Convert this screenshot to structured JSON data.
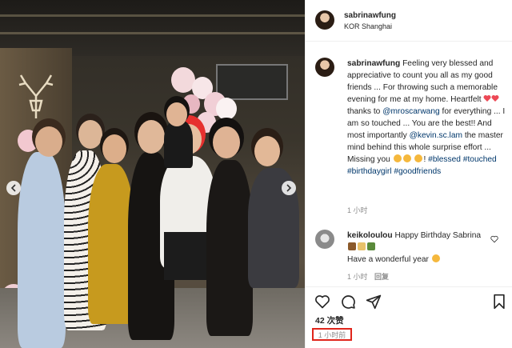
{
  "post": {
    "header": {
      "username": "sabrinawfung",
      "location": "KOR Shanghai"
    },
    "caption": {
      "username": "sabrinawfung",
      "text_1": "Feeling very blessed and appreciative to count you all as my good friends ... For throwing such a memorable evening for me at my home. Heartfelt",
      "text_2": "thanks to",
      "mention_1": "@mroscarwang",
      "text_3": "for everything ... I am so touched ... You are the best!! And most importantly",
      "mention_2": "@kevin.sc.lam",
      "text_4": "the master mind behind this whole surprise effort ... Missing you",
      "text_5": "!",
      "hashtags": [
        "#blessed",
        "#touched",
        "#birthdaygirl",
        "#goodfriends"
      ],
      "time": "1 小时"
    },
    "comment": {
      "username": "keikoloulou",
      "text_1": "Happy Birthday Sabrina",
      "text_2": "Have a wonderful year",
      "time": "1 小时",
      "reply_label": "回复"
    },
    "likes_text": "42 次赞",
    "timestamp": "1 小时前"
  },
  "icons": {
    "like": "heart-outline-icon",
    "comment": "comment-icon",
    "share": "paper-plane-icon",
    "save": "bookmark-icon",
    "prev": "chevron-left-icon",
    "next": "chevron-right-icon"
  },
  "colors": {
    "link": "#00376b",
    "muted": "#8e8e8e",
    "highlight_box": "#e0251b",
    "heart": "#ed4956"
  }
}
